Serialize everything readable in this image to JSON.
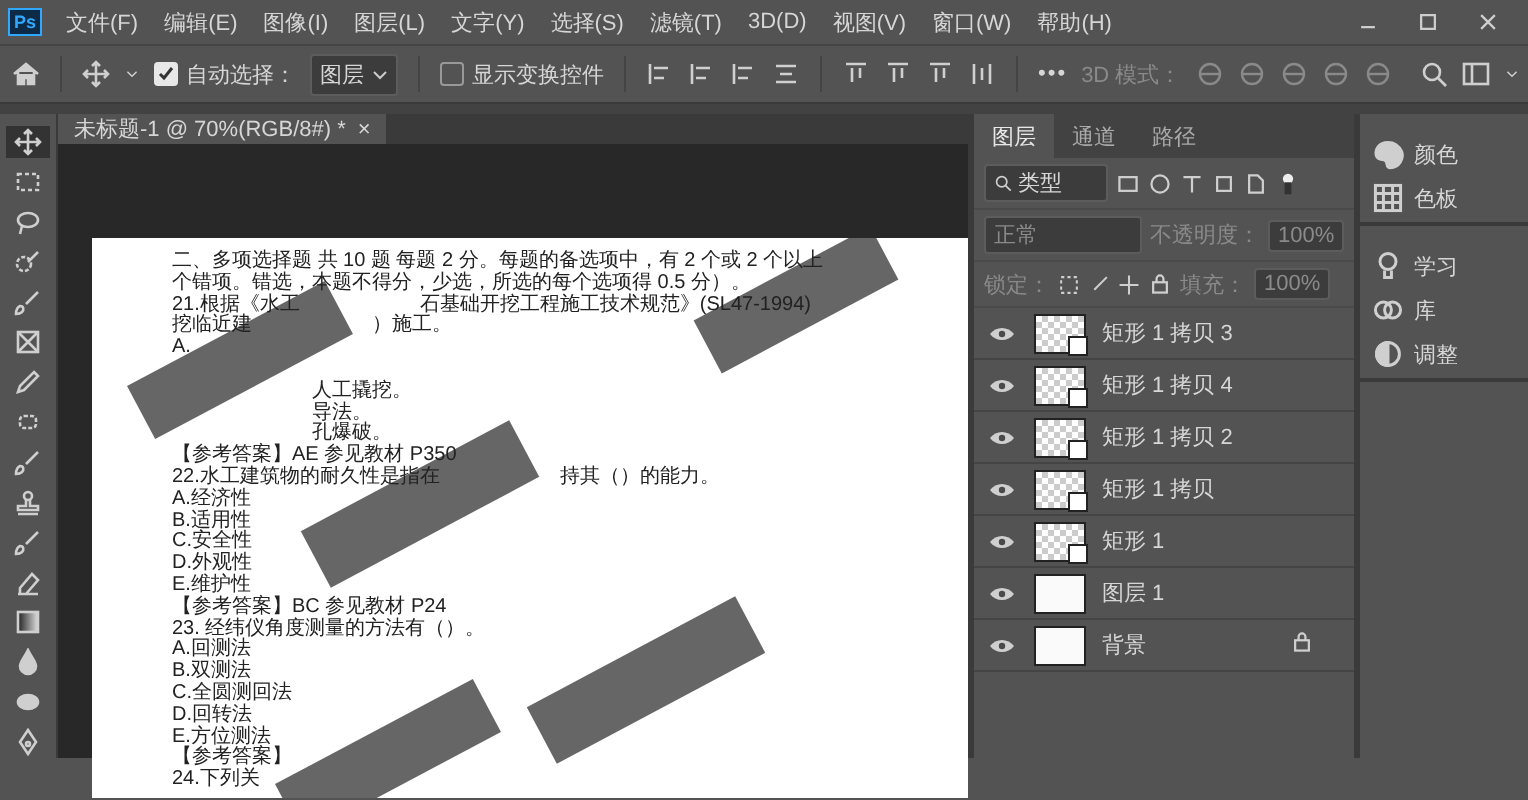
{
  "app_icon": "Ps",
  "menu": [
    "文件(F)",
    "编辑(E)",
    "图像(I)",
    "图层(L)",
    "文字(Y)",
    "选择(S)",
    "滤镜(T)",
    "3D(D)",
    "视图(V)",
    "窗口(W)",
    "帮助(H)"
  ],
  "options_bar": {
    "auto_select": {
      "label": "自动选择：",
      "checked": true
    },
    "target": "图层",
    "transform_controls": {
      "label": "显示变换控件",
      "checked": false
    },
    "more": "•••",
    "mode_3d": "3D 模式："
  },
  "toolbar": {
    "tools": [
      {
        "kind": "move",
        "selected": true
      },
      {
        "kind": "marquee",
        "selected": false
      },
      {
        "kind": "lasso",
        "selected": false
      },
      {
        "kind": "quick-select",
        "selected": false
      },
      {
        "kind": "brush",
        "selected": false
      },
      {
        "kind": "frame",
        "selected": false
      },
      {
        "kind": "eyedropper",
        "selected": false
      },
      {
        "kind": "patch",
        "selected": false
      },
      {
        "kind": "brush",
        "selected": false
      },
      {
        "kind": "stamp",
        "selected": false
      },
      {
        "kind": "brush",
        "selected": false
      },
      {
        "kind": "eraser",
        "selected": false
      },
      {
        "kind": "gradient",
        "selected": false
      },
      {
        "kind": "drop",
        "selected": false
      },
      {
        "kind": "dodge",
        "selected": false
      },
      {
        "kind": "pen",
        "selected": false
      }
    ]
  },
  "document_tab": {
    "title": "未标题-1 @ 70%(RGB/8#) *",
    "close": "×"
  },
  "document": {
    "lines": [
      [
        "二、多项选择题 共 10 题 每题 2 分。每题的备选项中，有 2 个或 2 个以上"
      ],
      [
        "个错项。错选，本题不得分，少选，所选的每个选项得 0.5 分）。"
      ],
      [
        "21.根据《水工",
        "石基础开挖工程施工技术规范》(SL47-1994)"
      ],
      [
        "挖临近建",
        "）施工。"
      ],
      [
        "A."
      ],
      {
        "kind": "spaced",
        "parts": [
          "人工撬挖。"
        ]
      },
      {
        "kind": "indented",
        "parts": [
          "导法。"
        ]
      },
      {
        "kind": "indented",
        "parts": [
          "孔爆破。"
        ]
      },
      [
        "【参考答案】AE 参见教材 P350"
      ],
      [
        "22.水工建筑物的耐久性是指在",
        "持其（）的能力。"
      ],
      [
        "A.经济性"
      ],
      [
        "B.适用性"
      ],
      [
        "C.安全性"
      ],
      [
        "D.外观性"
      ],
      [
        "E.维护性"
      ],
      [
        "【参考答案】BC 参见教材 P24"
      ],
      [
        "23. 经纬仪角度测量的方法有（）。"
      ],
      [
        "A.回测法"
      ],
      [
        "B.双测法"
      ],
      [
        "C.全圆测回法"
      ],
      [
        "D.回转法"
      ],
      [
        "E.方位测法"
      ],
      [
        "【参考答案】"
      ],
      [
        "24.下列关"
      ]
    ]
  },
  "layers_panel": {
    "tabs": [
      {
        "label": "图层",
        "selected": true
      },
      {
        "label": "通道",
        "selected": false
      },
      {
        "label": "路径",
        "selected": false
      }
    ],
    "filter": "类型",
    "blend_mode": "正常",
    "opacity_label": "不透明度：",
    "opacity": "100%",
    "lock_label": "锁定：",
    "fill_label": "填充：",
    "fill": "100%",
    "layers": [
      {
        "name": "矩形 1 拷贝 3",
        "kind": "shape",
        "visible": true,
        "locked": false
      },
      {
        "name": "矩形 1 拷贝 4",
        "kind": "shape",
        "visible": true,
        "locked": false
      },
      {
        "name": "矩形 1 拷贝 2",
        "kind": "shape",
        "visible": true,
        "locked": false
      },
      {
        "name": "矩形 1 拷贝",
        "kind": "shape",
        "visible": true,
        "locked": false
      },
      {
        "name": "矩形 1",
        "kind": "shape",
        "visible": true,
        "locked": false
      },
      {
        "name": "图层 1",
        "kind": "image",
        "visible": true,
        "locked": false
      },
      {
        "name": "背景",
        "kind": "image",
        "visible": true,
        "locked": true
      }
    ]
  },
  "side_panels": [
    [
      {
        "kind": "palette",
        "label": "颜色"
      },
      {
        "kind": "grid",
        "label": "色板"
      }
    ],
    [
      {
        "kind": "bulb",
        "label": "学习"
      },
      {
        "kind": "cloud",
        "label": "库"
      },
      {
        "kind": "half",
        "label": "调整"
      }
    ]
  ]
}
